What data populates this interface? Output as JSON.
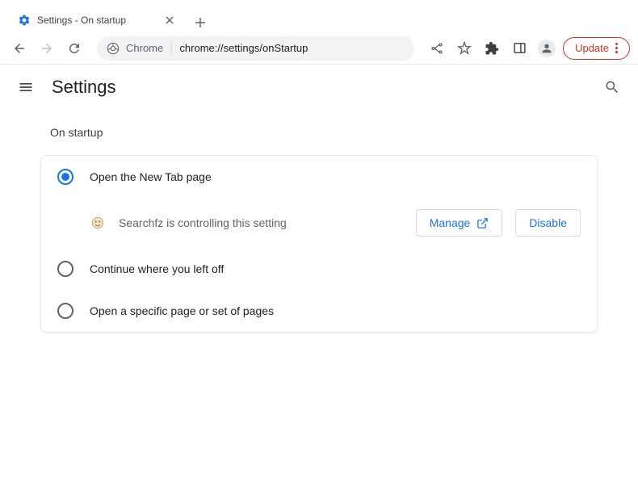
{
  "window": {
    "tab_title": "Settings - On startup"
  },
  "omnibox": {
    "prefix": "Chrome",
    "path": "chrome://settings/onStartup"
  },
  "toolbar": {
    "update_label": "Update"
  },
  "header": {
    "title": "Settings"
  },
  "section": {
    "title": "On startup"
  },
  "options": {
    "new_tab": "Open the New Tab page",
    "continue": "Continue where you left off",
    "specific": "Open a specific page or set of pages"
  },
  "extension": {
    "message": "Searchfz is controlling this setting",
    "manage_label": "Manage",
    "disable_label": "Disable"
  }
}
